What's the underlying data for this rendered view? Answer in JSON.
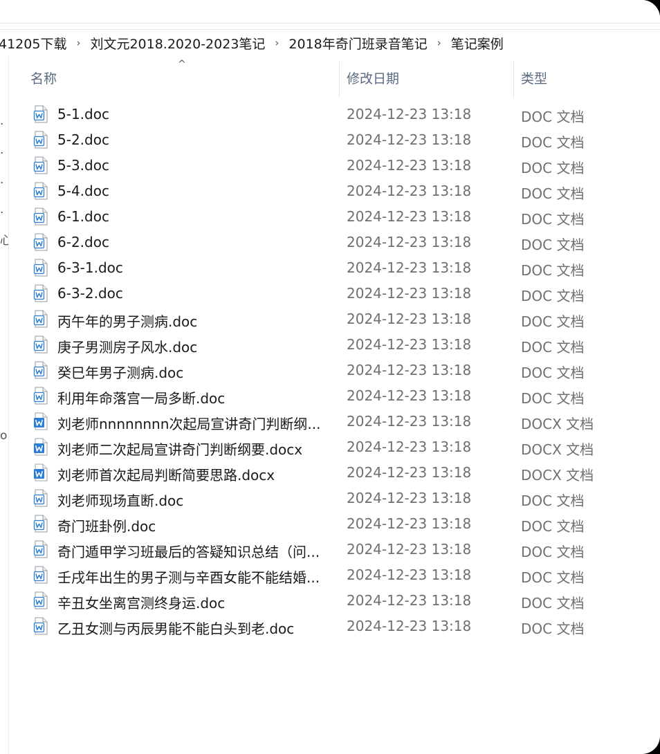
{
  "breadcrumb": [
    "41205下载",
    "刘文元2018.2020-2023笔记",
    "2018年奇门班录音笔记",
    "笔记案例"
  ],
  "breadcrumb_separator": "›",
  "left_fragments": [
    "·",
    "·",
    "·",
    "·",
    "心",
    "o"
  ],
  "columns": {
    "name": "名称",
    "date": "修改日期",
    "type": "类型",
    "sort_indicator": "^"
  },
  "icons": {
    "doc": "word-doc-outline-icon",
    "docx": "word-docx-filled-icon"
  },
  "colors": {
    "word_blue": "#2b7cd3",
    "header_text": "#5a6a80"
  },
  "files": [
    {
      "name": "5-1.doc",
      "date": "2024-12-23 13:18",
      "type": "DOC 文档",
      "kind": "doc"
    },
    {
      "name": "5-2.doc",
      "date": "2024-12-23 13:18",
      "type": "DOC 文档",
      "kind": "doc"
    },
    {
      "name": "5-3.doc",
      "date": "2024-12-23 13:18",
      "type": "DOC 文档",
      "kind": "doc"
    },
    {
      "name": "5-4.doc",
      "date": "2024-12-23 13:18",
      "type": "DOC 文档",
      "kind": "doc"
    },
    {
      "name": "6-1.doc",
      "date": "2024-12-23 13:18",
      "type": "DOC 文档",
      "kind": "doc"
    },
    {
      "name": "6-2.doc",
      "date": "2024-12-23 13:18",
      "type": "DOC 文档",
      "kind": "doc"
    },
    {
      "name": "6-3-1.doc",
      "date": "2024-12-23 13:18",
      "type": "DOC 文档",
      "kind": "doc"
    },
    {
      "name": "6-3-2.doc",
      "date": "2024-12-23 13:18",
      "type": "DOC 文档",
      "kind": "doc"
    },
    {
      "name": "丙午年的男子测病.doc",
      "date": "2024-12-23 13:18",
      "type": "DOC 文档",
      "kind": "doc"
    },
    {
      "name": "庚子男测房子风水.doc",
      "date": "2024-12-23 13:18",
      "type": "DOC 文档",
      "kind": "doc"
    },
    {
      "name": "癸巳年男子测病.doc",
      "date": "2024-12-23 13:18",
      "type": "DOC 文档",
      "kind": "doc"
    },
    {
      "name": "利用年命落宫一局多断.doc",
      "date": "2024-12-23 13:18",
      "type": "DOC 文档",
      "kind": "doc"
    },
    {
      "name": "刘老师nnnnnnnn次起局宣讲奇门判断纲...",
      "date": "2024-12-23 13:18",
      "type": "DOCX 文档",
      "kind": "docx"
    },
    {
      "name": "刘老师二次起局宣讲奇门判断纲要.docx",
      "date": "2024-12-23 13:18",
      "type": "DOCX 文档",
      "kind": "docx"
    },
    {
      "name": "刘老师首次起局判断简要思路.docx",
      "date": "2024-12-23 13:18",
      "type": "DOCX 文档",
      "kind": "docx"
    },
    {
      "name": "刘老师现场直断.doc",
      "date": "2024-12-23 13:18",
      "type": "DOC 文档",
      "kind": "doc"
    },
    {
      "name": "奇门班卦例.doc",
      "date": "2024-12-23 13:18",
      "type": "DOC 文档",
      "kind": "doc"
    },
    {
      "name": "奇门遁甲学习班最后的答疑知识总结（问...",
      "date": "2024-12-23 13:18",
      "type": "DOC 文档",
      "kind": "doc"
    },
    {
      "name": "壬戌年出生的男子测与辛酉女能不能结婚...",
      "date": "2024-12-23 13:18",
      "type": "DOC 文档",
      "kind": "doc"
    },
    {
      "name": "辛丑女坐离宫测终身运.doc",
      "date": "2024-12-23 13:18",
      "type": "DOC 文档",
      "kind": "doc"
    },
    {
      "name": "乙丑女测与丙辰男能不能白头到老.doc",
      "date": "2024-12-23 13:18",
      "type": "DOC 文档",
      "kind": "doc"
    }
  ]
}
